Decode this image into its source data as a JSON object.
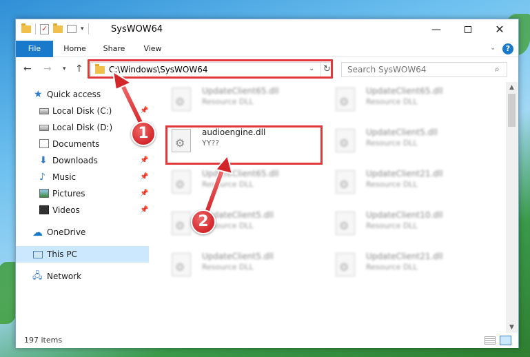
{
  "window": {
    "title": "SysWOW64"
  },
  "ribbon": {
    "tabs": [
      "File",
      "Home",
      "Share",
      "View"
    ],
    "help_label": "?"
  },
  "navbar": {
    "address": "C:\\Windows\\SysWOW64",
    "search_placeholder": "Search SysWOW64"
  },
  "sidebar": {
    "items": [
      {
        "label": "Quick access",
        "icon": "star-icon"
      },
      {
        "label": "Local Disk (C:)",
        "icon": "disk-icon"
      },
      {
        "label": "Local Disk (D:)",
        "icon": "disk-icon"
      },
      {
        "label": "Documents",
        "icon": "documents-icon"
      },
      {
        "label": "Downloads",
        "icon": "download-icon"
      },
      {
        "label": "Music",
        "icon": "music-icon"
      },
      {
        "label": "Pictures",
        "icon": "pictures-icon"
      },
      {
        "label": "Videos",
        "icon": "videos-icon"
      },
      {
        "label": "OneDrive",
        "icon": "cloud-icon"
      },
      {
        "label": "This PC",
        "icon": "computer-icon",
        "selected": true
      },
      {
        "label": "Network",
        "icon": "network-icon"
      }
    ]
  },
  "files": {
    "left": [
      {
        "name": "UpdateClient65.dll",
        "type": "Resource DLL"
      },
      {
        "name": "audioengine.dll",
        "type": "YY??"
      },
      {
        "name": "UpdateClient65.dll",
        "type": "Resource DLL"
      },
      {
        "name": "UpdateClient5.dll",
        "type": "Resource DLL"
      },
      {
        "name": "UpdateClient5.dll",
        "type": "Resource DLL"
      }
    ],
    "right": [
      {
        "name": "UpdateClient65.dll",
        "type": "Resource DLL"
      },
      {
        "name": "UpdateClient5.dll",
        "type": "Resource DLL"
      },
      {
        "name": "UpdateClient21.dll",
        "type": "Resource DLL"
      },
      {
        "name": "UpdateClient10.dll",
        "type": "Resource DLL"
      },
      {
        "name": "UpdateClient21.dll",
        "type": "Resource DLL"
      }
    ]
  },
  "status": {
    "item_count": "197 items"
  },
  "annotations": {
    "step1": "1",
    "step2": "2",
    "highlight_color": "#e0383c"
  }
}
